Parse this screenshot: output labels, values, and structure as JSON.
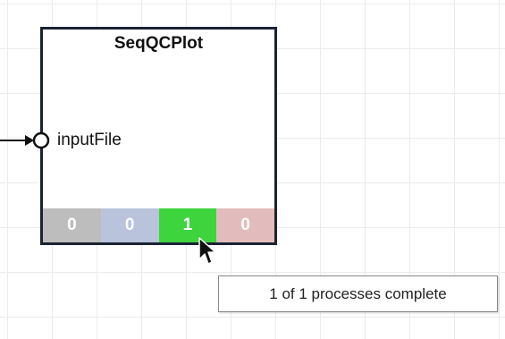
{
  "node": {
    "title": "SeqQCPlot",
    "input_port": {
      "label": "inputFile"
    },
    "status": {
      "waiting": "0",
      "running": "0",
      "complete": "1",
      "failed": "0"
    },
    "colors": {
      "border": "#1b2233",
      "waiting": "#bdbdbd",
      "running": "#b9c4dc",
      "complete": "#3ed43e",
      "failed": "#e2bcbc"
    }
  },
  "tooltip": {
    "text": "1 of 1 processes complete"
  },
  "icons": {
    "port": "input-port-circle-icon",
    "connector": "arrow-right-icon",
    "pointer": "mouse-cursor-icon"
  }
}
